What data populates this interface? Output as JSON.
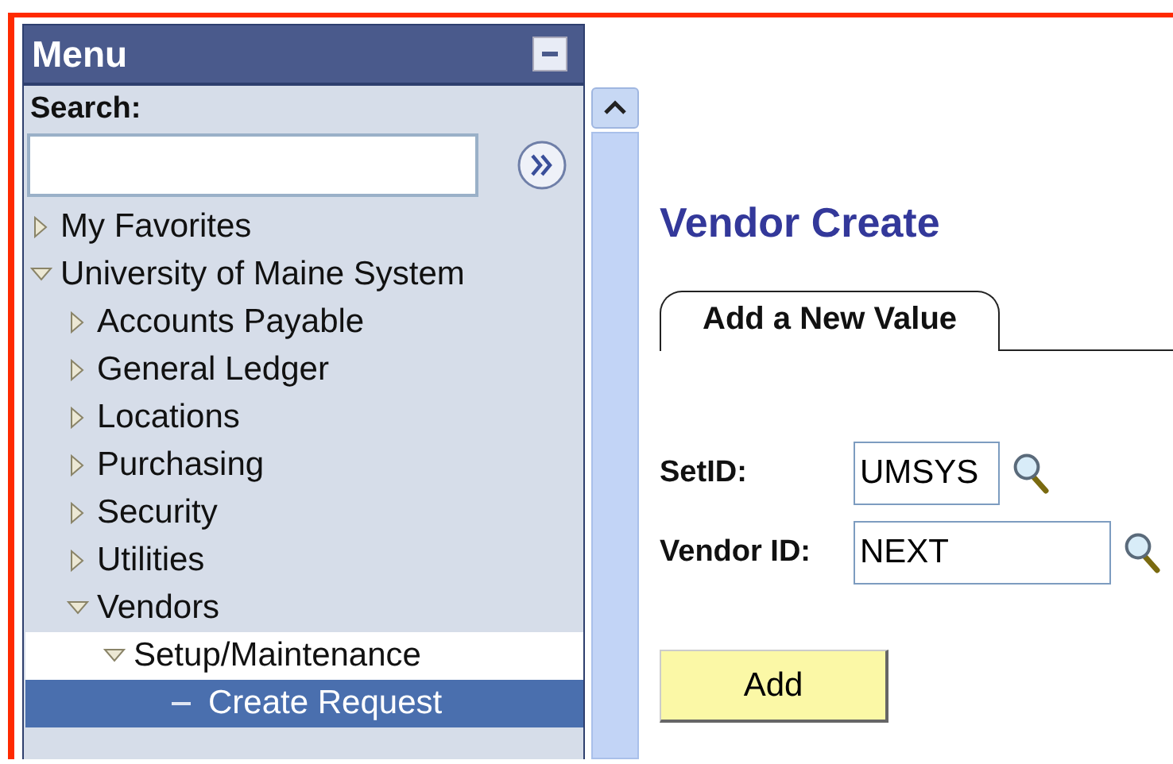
{
  "menu": {
    "title": "Menu",
    "search": {
      "label": "Search:"
    },
    "tree": [
      {
        "label": "My Favorites",
        "expanded": false,
        "selected": false,
        "highlighted": false
      },
      {
        "label": "University of Maine System",
        "expanded": true,
        "selected": false,
        "highlighted": false,
        "children": [
          {
            "label": "Accounts Payable",
            "expanded": false,
            "selected": false,
            "highlighted": false
          },
          {
            "label": "General Ledger",
            "expanded": false,
            "selected": false,
            "highlighted": false
          },
          {
            "label": "Locations",
            "expanded": false,
            "selected": false,
            "highlighted": false
          },
          {
            "label": "Purchasing",
            "expanded": false,
            "selected": false,
            "highlighted": false
          },
          {
            "label": "Security",
            "expanded": false,
            "selected": false,
            "highlighted": false
          },
          {
            "label": "Utilities",
            "expanded": false,
            "selected": false,
            "highlighted": false
          },
          {
            "label": "Vendors",
            "expanded": true,
            "selected": false,
            "highlighted": false,
            "children": [
              {
                "label": "Setup/Maintenance",
                "expanded": true,
                "selected": false,
                "highlighted": true,
                "children": [
                  {
                    "label": "Create Request",
                    "kind": "leaf",
                    "selected": true,
                    "highlighted": false
                  }
                ]
              }
            ]
          }
        ]
      }
    ]
  },
  "page": {
    "title": "Vendor Create",
    "tabs": [
      {
        "label": "Add a New Value",
        "selected": true
      }
    ],
    "fields": [
      {
        "label": "SetID:",
        "value": "UMSYS"
      },
      {
        "label": "Vendor ID:",
        "value": "NEXT"
      }
    ],
    "button": "Add"
  }
}
